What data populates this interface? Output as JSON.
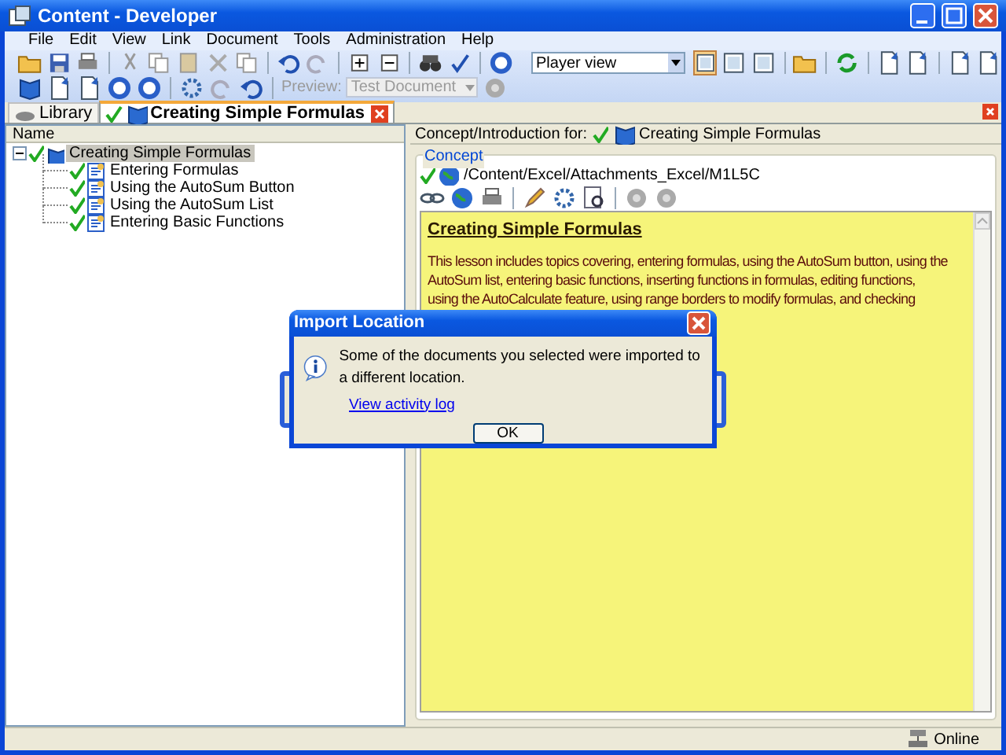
{
  "window": {
    "title": "Content - Developer"
  },
  "menu": [
    "File",
    "Edit",
    "View",
    "Link",
    "Document",
    "Tools",
    "Administration",
    "Help"
  ],
  "toolbar": {
    "view_select": {
      "value": "Player view"
    },
    "preview_label": {
      "text": "Preview:",
      "disabled": true
    },
    "preview_select": {
      "value": "Test Document",
      "disabled": true
    }
  },
  "tabs": [
    {
      "label": "Library",
      "selected": false
    },
    {
      "label": "Creating Simple Formulas",
      "selected": true
    }
  ],
  "tree": {
    "column": "Name",
    "items": [
      {
        "label": "Creating Simple Formulas",
        "selected": true,
        "expanded": true,
        "children": [
          {
            "label": "Entering Formulas",
            "selected": false
          },
          {
            "label": "Using the AutoSum Button",
            "selected": false
          },
          {
            "label": "Using the AutoSum List",
            "selected": false
          },
          {
            "label": "Entering Basic Functions",
            "selected": false
          }
        ]
      }
    ]
  },
  "detail": {
    "header_label": "Concept/Introduction for:",
    "header_title": "Creating Simple Formulas",
    "group_label": "Concept",
    "path": "/Content/Excel/Attachments_Excel/M1L5C",
    "content_title": "Creating Simple Formulas",
    "content_lines": [
      "This lesson includes topics covering, entering formulas, using the AutoSum button, using the",
      "AutoSum list, entering basic functions, inserting functions in formulas, editing functions,",
      "using the AutoCalculate feature, using range borders to modify formulas, and checking"
    ]
  },
  "dialog": {
    "title": "Import Location",
    "message": "Some of the documents you selected were imported to a different location.",
    "link": "View activity log",
    "button": "OK"
  },
  "status_bar": {
    "status": "Online"
  }
}
